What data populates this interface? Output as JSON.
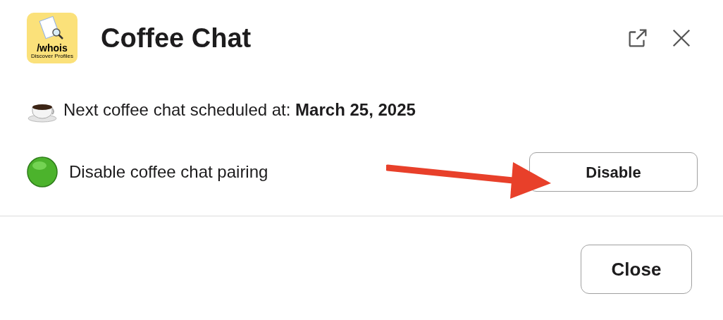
{
  "app_logo": {
    "name": "/whois",
    "tagline": "Discover Profiles"
  },
  "title": "Coffee Chat",
  "schedule": {
    "text": "Next coffee chat scheduled at: **March 25, 2025**"
  },
  "pairing": {
    "label": "Disable coffee chat pairing",
    "button": "Disable"
  },
  "annotation": {
    "kind": "arrow",
    "color": "#e8402a"
  },
  "footer": {
    "close_button": "Close"
  }
}
